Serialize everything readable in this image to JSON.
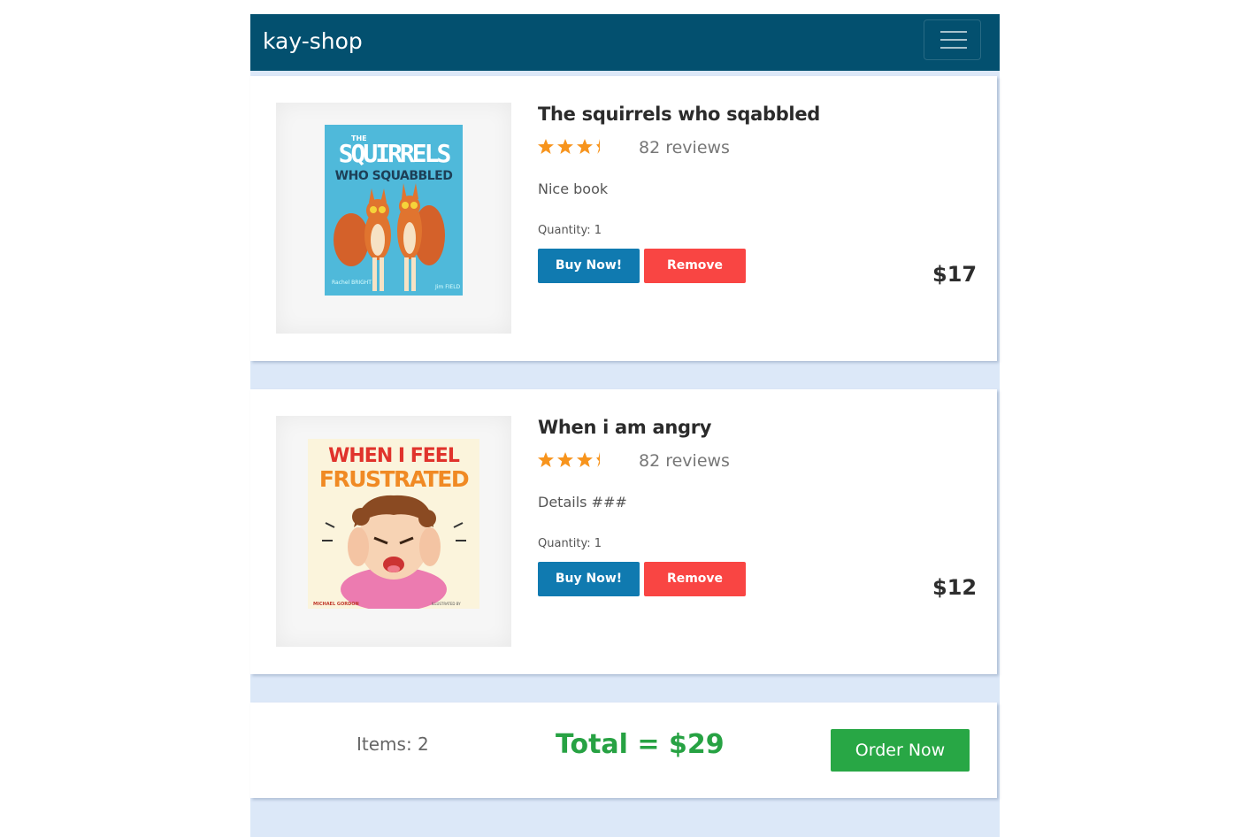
{
  "navbar": {
    "brand": "kay-shop",
    "menu_icon": "hamburger-menu-icon"
  },
  "cart": {
    "products": [
      {
        "title": "The squirrels who sqabbled",
        "rating": 3.5,
        "reviews": "82 reviews",
        "description": "Nice book",
        "quantity": "Quantity: 1",
        "buy_label": "Buy Now!",
        "remove_label": "Remove",
        "price": "$17",
        "cover": {
          "title_line1": "THE",
          "title_line2": "SQUIRRELS",
          "title_line3": "WHO SQUABBLED",
          "author_left": "Rachel BRIGHT",
          "author_right": "Jim FIELD"
        }
      },
      {
        "title": "When i am angry",
        "rating": 3.5,
        "reviews": "82 reviews",
        "description": "Details ###",
        "quantity": "Quantity: 1",
        "buy_label": "Buy Now!",
        "remove_label": "Remove",
        "price": "$12",
        "cover": {
          "title_line1": "WHEN I FEEL",
          "title_line2": "FRUSTRATED",
          "author_left": "MICHAEL GORDON",
          "author_right": "ILLUSTRATED BY"
        }
      }
    ],
    "summary": {
      "items": "Items: 2",
      "total": "Total = $29",
      "order_label": "Order Now"
    }
  },
  "colors": {
    "navbar": "#03506f",
    "buy": "#107ab0",
    "remove": "#f94543",
    "total": "#27a243",
    "order": "#28a745",
    "star": "#f7941d",
    "background": "#dce8f8"
  }
}
